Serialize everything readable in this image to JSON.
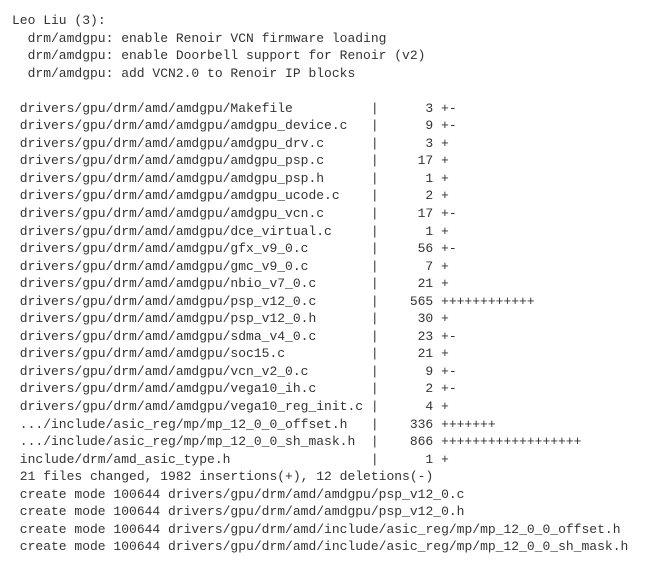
{
  "author": "Leo Liu (3):",
  "commits": [
    "drm/amdgpu: enable Renoir VCN firmware loading",
    "drm/amdgpu: enable Doorbell support for Renoir (v2)",
    "drm/amdgpu: add VCN2.0 to Renoir IP blocks"
  ],
  "diffstat": [
    {
      "file": "drivers/gpu/drm/amd/amdgpu/Makefile",
      "num": "3",
      "graph": "+-"
    },
    {
      "file": "drivers/gpu/drm/amd/amdgpu/amdgpu_device.c",
      "num": "9",
      "graph": "+-"
    },
    {
      "file": "drivers/gpu/drm/amd/amdgpu/amdgpu_drv.c",
      "num": "3",
      "graph": "+"
    },
    {
      "file": "drivers/gpu/drm/amd/amdgpu/amdgpu_psp.c",
      "num": "17",
      "graph": "+"
    },
    {
      "file": "drivers/gpu/drm/amd/amdgpu/amdgpu_psp.h",
      "num": "1",
      "graph": "+"
    },
    {
      "file": "drivers/gpu/drm/amd/amdgpu/amdgpu_ucode.c",
      "num": "2",
      "graph": "+"
    },
    {
      "file": "drivers/gpu/drm/amd/amdgpu/amdgpu_vcn.c",
      "num": "17",
      "graph": "+-"
    },
    {
      "file": "drivers/gpu/drm/amd/amdgpu/dce_virtual.c",
      "num": "1",
      "graph": "+"
    },
    {
      "file": "drivers/gpu/drm/amd/amdgpu/gfx_v9_0.c",
      "num": "56",
      "graph": "+-"
    },
    {
      "file": "drivers/gpu/drm/amd/amdgpu/gmc_v9_0.c",
      "num": "7",
      "graph": "+"
    },
    {
      "file": "drivers/gpu/drm/amd/amdgpu/nbio_v7_0.c",
      "num": "21",
      "graph": "+"
    },
    {
      "file": "drivers/gpu/drm/amd/amdgpu/psp_v12_0.c",
      "num": "565",
      "graph": "++++++++++++"
    },
    {
      "file": "drivers/gpu/drm/amd/amdgpu/psp_v12_0.h",
      "num": "30",
      "graph": "+"
    },
    {
      "file": "drivers/gpu/drm/amd/amdgpu/sdma_v4_0.c",
      "num": "23",
      "graph": "+-"
    },
    {
      "file": "drivers/gpu/drm/amd/amdgpu/soc15.c",
      "num": "21",
      "graph": "+"
    },
    {
      "file": "drivers/gpu/drm/amd/amdgpu/vcn_v2_0.c",
      "num": "9",
      "graph": "+-"
    },
    {
      "file": "drivers/gpu/drm/amd/amdgpu/vega10_ih.c",
      "num": "2",
      "graph": "+-"
    },
    {
      "file": "drivers/gpu/drm/amd/amdgpu/vega10_reg_init.c",
      "num": "4",
      "graph": "+"
    },
    {
      "file": ".../include/asic_reg/mp/mp_12_0_0_offset.h",
      "num": "336",
      "graph": "+++++++"
    },
    {
      "file": ".../include/asic_reg/mp/mp_12_0_0_sh_mask.h",
      "num": "866",
      "graph": "++++++++++++++++++"
    },
    {
      "file": "include/drm/amd_asic_type.h",
      "num": "1",
      "graph": "+"
    }
  ],
  "summary": "21 files changed, 1982 insertions(+), 12 deletions(-)",
  "creates": [
    "create mode 100644 drivers/gpu/drm/amd/amdgpu/psp_v12_0.c",
    "create mode 100644 drivers/gpu/drm/amd/amdgpu/psp_v12_0.h",
    "create mode 100644 drivers/gpu/drm/amd/include/asic_reg/mp/mp_12_0_0_offset.h",
    "create mode 100644 drivers/gpu/drm/amd/include/asic_reg/mp/mp_12_0_0_sh_mask.h"
  ],
  "layout": {
    "file_col_ch": 44,
    "sep_col_ch": 3,
    "num_col_ch": 6
  }
}
